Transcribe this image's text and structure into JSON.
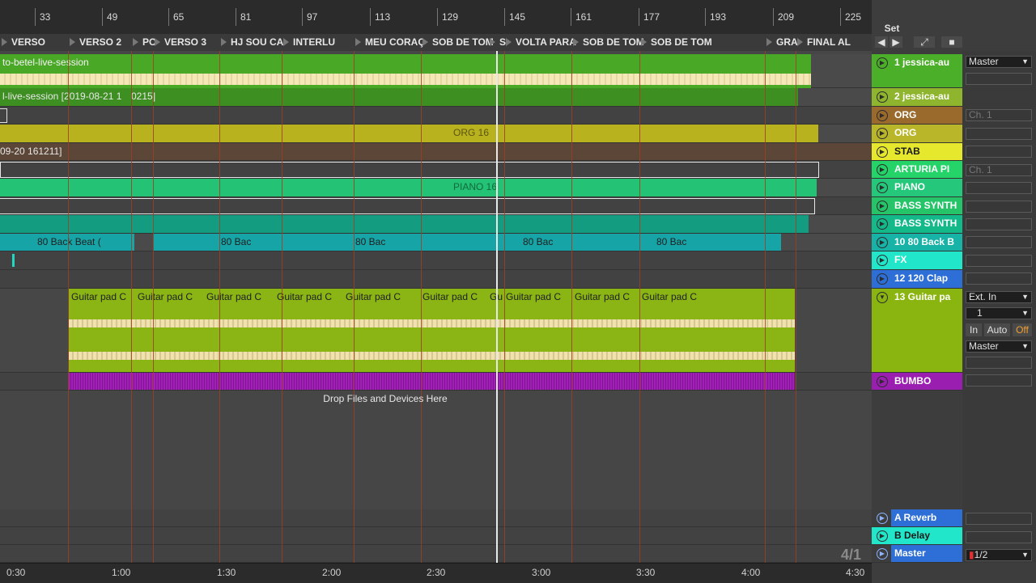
{
  "ruler": {
    "bars": [
      "33",
      "49",
      "65",
      "81",
      "97",
      "113",
      "129",
      "145",
      "161",
      "177",
      "193",
      "209",
      "225"
    ]
  },
  "locators": [
    "VERSO",
    "VERSO 2",
    "PO",
    "VERSO 3",
    "HJ SOU CA",
    "INTERLU",
    "MEU CORAÇ",
    "SOB DE TOM",
    "S",
    "VOLTA PARA",
    "SOB DE TOM",
    "SOB DE TOM",
    "GRA",
    "FINAL AL"
  ],
  "tracks": {
    "t1_clip": "to-betel-live-session",
    "t2_clip": "l-live-session [2019-08-21 1",
    "t2_clip_b": "0215]",
    "t5_clip": "09-20 161211]",
    "org_clip": "ORG 16",
    "piano_clip": "PIANO 16",
    "beat_first": "80 Back Beat (",
    "beat_rest": "80 Bac",
    "guitar_clip": "Guitar pad C",
    "guitar_short": "Gu"
  },
  "drop_hint": "Drop Files and Devices Here",
  "timeline": [
    "0:30",
    "1:00",
    "1:30",
    "2:00",
    "2:30",
    "3:00",
    "3:30",
    "4:00",
    "4:30"
  ],
  "set_label": "Set",
  "grid_label": "4/1",
  "headers": [
    {
      "name": "1 jessica-au",
      "color": "#4caf2a"
    },
    {
      "name": "2 jessica-au",
      "color": "#8fb52e"
    },
    {
      "name": "ORG",
      "color": "#9a6a2d"
    },
    {
      "name": "ORG",
      "color": "#b9b62a"
    },
    {
      "name": "STAB",
      "color": "#e6e82e"
    },
    {
      "name": "ARTURIA PI",
      "color": "#25d468"
    },
    {
      "name": "PIANO",
      "color": "#25c77b"
    },
    {
      "name": "BASS SYNTH",
      "color": "#26c469"
    },
    {
      "name": "BASS SYNTH",
      "color": "#14b98a"
    },
    {
      "name": "10 80 Back B",
      "color": "#16b3a6"
    },
    {
      "name": "FX",
      "color": "#22e6c9"
    },
    {
      "name": "12 120 Clap",
      "color": "#2d6fd6"
    },
    {
      "name": "13 Guitar pa",
      "color": "#8ab510"
    },
    {
      "name": "BUMBO",
      "color": "#9a1fb0"
    },
    {
      "name": "A Reverb",
      "color": "#2d6fd6"
    },
    {
      "name": "B Delay",
      "color": "#22e6c9"
    },
    {
      "name": "Master",
      "color": "#2d6fd6"
    }
  ],
  "io": {
    "master": "Master",
    "ch1": "Ch. 1",
    "ext_in": "Ext. In",
    "input_ch": "1",
    "monitor": [
      "In",
      "Auto",
      "Off"
    ],
    "out_master": "Master",
    "cue": "1/2"
  },
  "colors": {
    "accent_orange": "#f0a030",
    "playhead": "#e8e8e8"
  }
}
